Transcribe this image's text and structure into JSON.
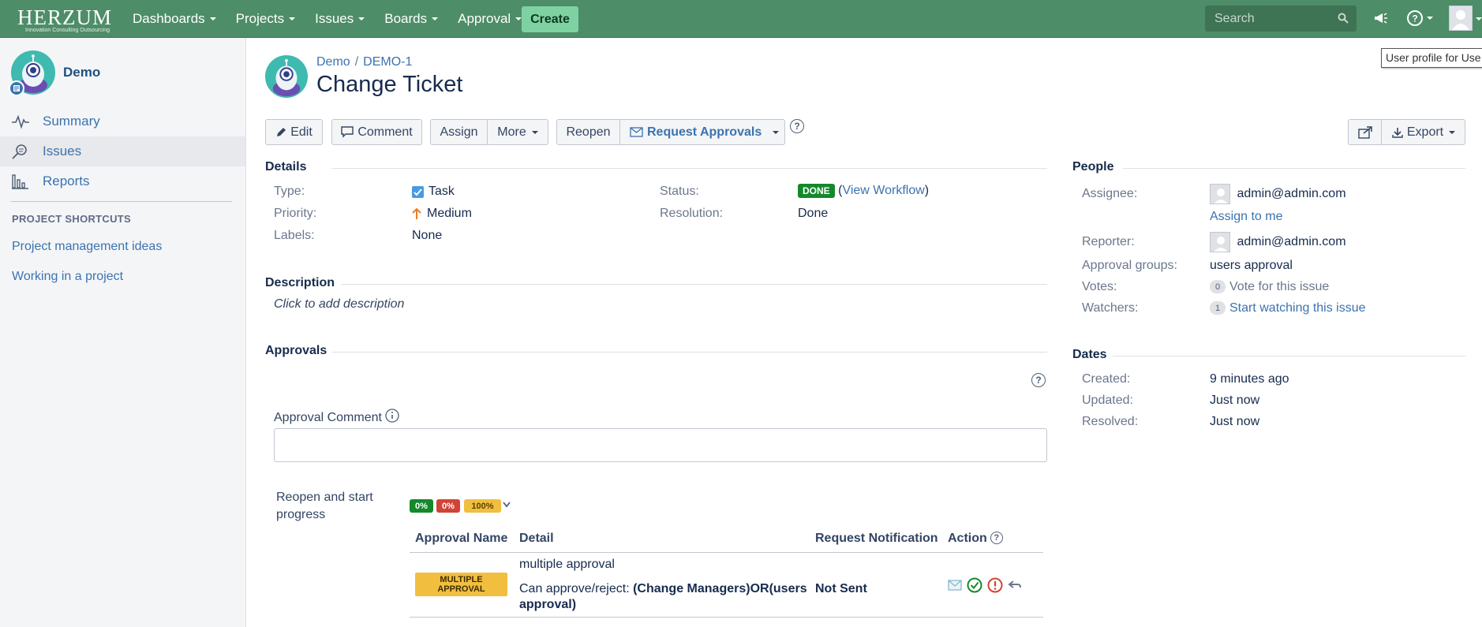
{
  "topbar": {
    "logo": "HERZUM",
    "logo_tagline": "Innovation Consulting Outsourcing",
    "nav": [
      "Dashboards",
      "Projects",
      "Issues",
      "Boards",
      "Approval"
    ],
    "create_label": "Create",
    "search_placeholder": "Search",
    "bg_color": "#4d8d68"
  },
  "tooltip": "User profile for Use",
  "sidebar": {
    "project_name": "Demo",
    "items": [
      {
        "label": "Summary",
        "icon": "activity-icon"
      },
      {
        "label": "Issues",
        "icon": "issues-search-icon"
      },
      {
        "label": "Reports",
        "icon": "bar-chart-icon"
      }
    ],
    "shortcuts_heading": "PROJECT SHORTCUTS",
    "shortcuts": [
      "Project management ideas",
      "Working in a project"
    ]
  },
  "issue": {
    "breadcrumb_project": "Demo",
    "breadcrumb_key": "DEMO-1",
    "title": "Change Ticket"
  },
  "toolbar": {
    "edit": "Edit",
    "comment": "Comment",
    "assign": "Assign",
    "more": "More",
    "reopen": "Reopen",
    "request_approvals": "Request Approvals",
    "export": "Export"
  },
  "details": {
    "heading": "Details",
    "type_label": "Type:",
    "type_value": "Task",
    "priority_label": "Priority:",
    "priority_value": "Medium",
    "labels_label": "Labels:",
    "labels_value": "None",
    "status_label": "Status:",
    "status_value": "DONE",
    "view_workflow": "View Workflow",
    "resolution_label": "Resolution:",
    "resolution_value": "Done"
  },
  "description": {
    "heading": "Description",
    "placeholder": "Click to add description"
  },
  "approvals": {
    "heading": "Approvals",
    "comment_label": "Approval Comment",
    "transition": "Reopen and start progress",
    "pct_approved": "0%",
    "pct_rejected": "0%",
    "pct_pending": "100%",
    "columns": [
      "Approval Name",
      "Detail",
      "Request Notification",
      "Action"
    ],
    "row": {
      "name": "MULTIPLE APPROVAL",
      "detail_title": "multiple approval",
      "detail_prefix": "Can approve/reject:",
      "detail_groups": "(Change Managers)OR(users approval)",
      "notification": "Not Sent"
    }
  },
  "people": {
    "heading": "People",
    "assignee_label": "Assignee:",
    "assignee": "admin@admin.com",
    "assign_to_me": "Assign to me",
    "reporter_label": "Reporter:",
    "reporter": "admin@admin.com",
    "approval_groups_label": "Approval groups:",
    "approval_groups": "users approval",
    "votes_label": "Votes:",
    "votes_count": "0",
    "vote_link": "Vote for this issue",
    "watchers_label": "Watchers:",
    "watchers_count": "1",
    "watch_link": "Start watching this issue"
  },
  "dates": {
    "heading": "Dates",
    "created_label": "Created:",
    "created": "9 minutes ago",
    "updated_label": "Updated:",
    "updated": "Just now",
    "resolved_label": "Resolved:",
    "resolved": "Just now"
  }
}
